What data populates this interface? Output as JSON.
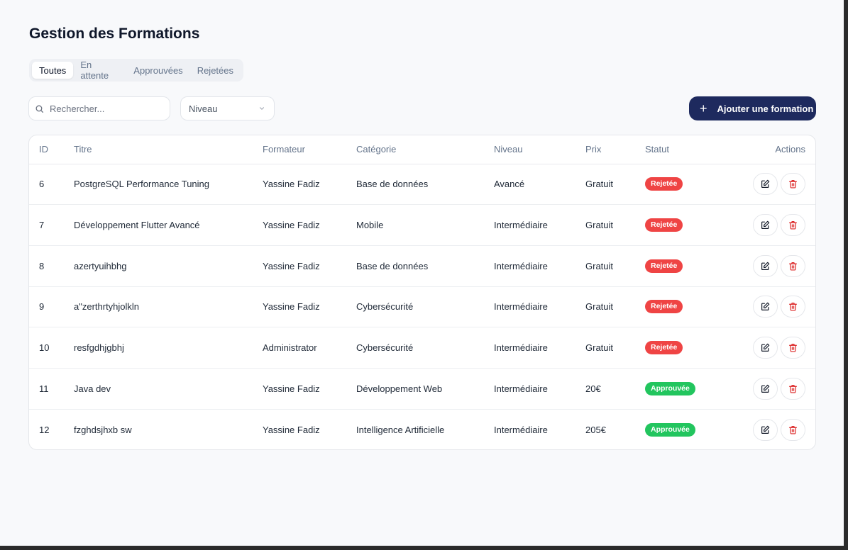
{
  "page": {
    "title": "Gestion des Formations"
  },
  "tabs": [
    {
      "label": "Toutes",
      "active": true
    },
    {
      "label": "En attente",
      "active": false
    },
    {
      "label": "Approuvées",
      "active": false
    },
    {
      "label": "Rejetées",
      "active": false
    }
  ],
  "search": {
    "placeholder": "Rechercher..."
  },
  "filter": {
    "label": "Niveau"
  },
  "add_button": {
    "label": "Ajouter une formation",
    "icon": "plus-icon"
  },
  "colors": {
    "primary": "#1e2a5e",
    "rejected": "#ef4444",
    "approved": "#22c55e",
    "delete": "#dc2626"
  },
  "table": {
    "columns": {
      "id": "ID",
      "titre": "Titre",
      "formateur": "Formateur",
      "categorie": "Catégorie",
      "niveau": "Niveau",
      "prix": "Prix",
      "statut": "Statut",
      "actions": "Actions"
    },
    "rows": [
      {
        "id": "6",
        "titre": "PostgreSQL Performance Tuning",
        "formateur": "Yassine Fadiz",
        "categorie": "Base de données",
        "niveau": "Avancé",
        "prix": "Gratuit",
        "statut": "Rejetée",
        "status_type": "rejected"
      },
      {
        "id": "7",
        "titre": "Développement Flutter Avancé",
        "formateur": "Yassine Fadiz",
        "categorie": "Mobile",
        "niveau": "Intermédiaire",
        "prix": "Gratuit",
        "statut": "Rejetée",
        "status_type": "rejected"
      },
      {
        "id": "8",
        "titre": "azertyuihbhg",
        "formateur": "Yassine Fadiz",
        "categorie": "Base de données",
        "niveau": "Intermédiaire",
        "prix": "Gratuit",
        "statut": "Rejetée",
        "status_type": "rejected"
      },
      {
        "id": "9",
        "titre": "a\"zerthrtyhjolkln",
        "formateur": "Yassine Fadiz",
        "categorie": "Cybersécurité",
        "niveau": "Intermédiaire",
        "prix": "Gratuit",
        "statut": "Rejetée",
        "status_type": "rejected"
      },
      {
        "id": "10",
        "titre": "resfgdhjgbhj",
        "formateur": "Administrator",
        "categorie": "Cybersécurité",
        "niveau": "Intermédiaire",
        "prix": "Gratuit",
        "statut": "Rejetée",
        "status_type": "rejected"
      },
      {
        "id": "11",
        "titre": "Java dev",
        "formateur": "Yassine Fadiz",
        "categorie": "Développement Web",
        "niveau": "Intermédiaire",
        "prix": "20€",
        "statut": "Approuvée",
        "status_type": "approved"
      },
      {
        "id": "12",
        "titre": "fzghdsjhxb sw",
        "formateur": "Yassine Fadiz",
        "categorie": "Intelligence Artificielle",
        "niveau": "Intermédiaire",
        "prix": "205€",
        "statut": "Approuvée",
        "status_type": "approved"
      }
    ]
  }
}
